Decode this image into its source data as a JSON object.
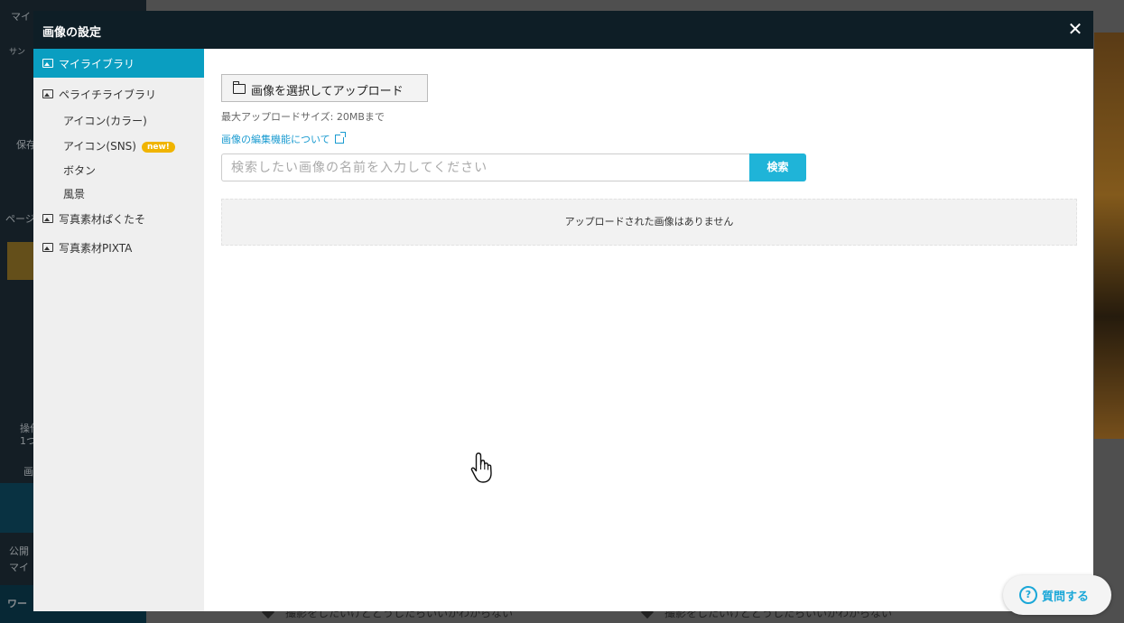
{
  "background": {
    "sidebar_texts": [
      "マイ",
      "サン",
      "保存",
      "ページ",
      "操作",
      "1つ",
      "画像",
      "公開",
      "マイ",
      "ワー"
    ],
    "footer_texts": [
      "撮影をしたいけどどうしたらいいかわからない",
      "撮影をしたいけどどうしたらいいかわからない"
    ]
  },
  "modal": {
    "title": "画像の設定",
    "close_label": "✕",
    "sidebar": {
      "items": [
        {
          "label": "マイライブラリ",
          "active": true
        },
        {
          "label": "ペライチライブラリ",
          "active": false
        },
        {
          "label": "写真素材ぱくたそ",
          "active": false
        },
        {
          "label": "写真素材PIXTA",
          "active": false
        }
      ],
      "subitems": [
        {
          "label": "アイコン(カラー)"
        },
        {
          "label": "アイコン(SNS)",
          "badge": "new!"
        },
        {
          "label": "ボタン"
        },
        {
          "label": "風景"
        }
      ]
    },
    "upload_button": "画像を選択してアップロード",
    "max_upload_size": "最大アップロードサイズ: 20MBまで",
    "edit_link": "画像の編集機能について",
    "search": {
      "placeholder": "検索したい画像の名前を入力してください",
      "value": "",
      "button": "検索"
    },
    "empty_message": "アップロードされた画像はありません"
  },
  "help_button": "質問する",
  "colors": {
    "accent": "#0a9ec1",
    "search_button": "#1fb4d8",
    "header": "#0e1e26",
    "badge": "#f0b400",
    "link": "#1a9bd0"
  }
}
